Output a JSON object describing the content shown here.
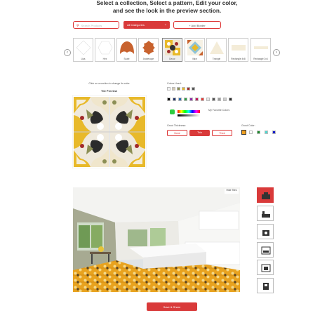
{
  "header": {
    "line1": "Select a collection, Select a pattern, Edit your color,",
    "line2": "and see the look in the preview section."
  },
  "search": {
    "placeholder": "Search Products"
  },
  "category": {
    "selected": "All Categories"
  },
  "add_border": {
    "label": "+ Add Border"
  },
  "shapes": [
    {
      "label": "Lisa"
    },
    {
      "label": "Hex"
    },
    {
      "label": "Scale"
    },
    {
      "label": "Arabesque"
    },
    {
      "label": "Decor"
    },
    {
      "label": "Valor"
    },
    {
      "label": "Triangle"
    },
    {
      "label": "Rectangle 4x8"
    },
    {
      "label": "Rectangle 2x4"
    }
  ],
  "tile_editor": {
    "instruction": "Click on a section to change its color",
    "preview_title": "Tile Preview"
  },
  "colors": {
    "label": "Colors Used:",
    "favorite_label": "My Favorite Colors"
  },
  "grout": {
    "thickness_label": "Grout Thickness:",
    "options": [
      "None",
      "Thin",
      "Thick"
    ],
    "selected": "Thin",
    "color_label": "Grout Color:"
  },
  "room": {
    "hide_label": "Hide Tiles"
  },
  "save_button": {
    "label": "Save & Share"
  },
  "palette": {
    "used": [
      "#f2f2f2",
      "#d6c9b2",
      "#8c8f55",
      "#e8b92a",
      "#a12b2b",
      "#555555"
    ],
    "row": [
      "#000000",
      "#1b2f66",
      "#2a6bb3",
      "#2f9c46",
      "#8f2ba8",
      "#c2185b",
      "#e53935",
      "#e4e4e4",
      "#555555",
      "#999999",
      "#cccccc",
      "#2b2b2b"
    ],
    "grout": [
      "#f0a020",
      "#ffffff",
      "#1a8a2a",
      "#4fd8d0",
      "#1018c8"
    ],
    "accent": "#d93a3a",
    "favorite_swatch": "#2ecc40"
  }
}
